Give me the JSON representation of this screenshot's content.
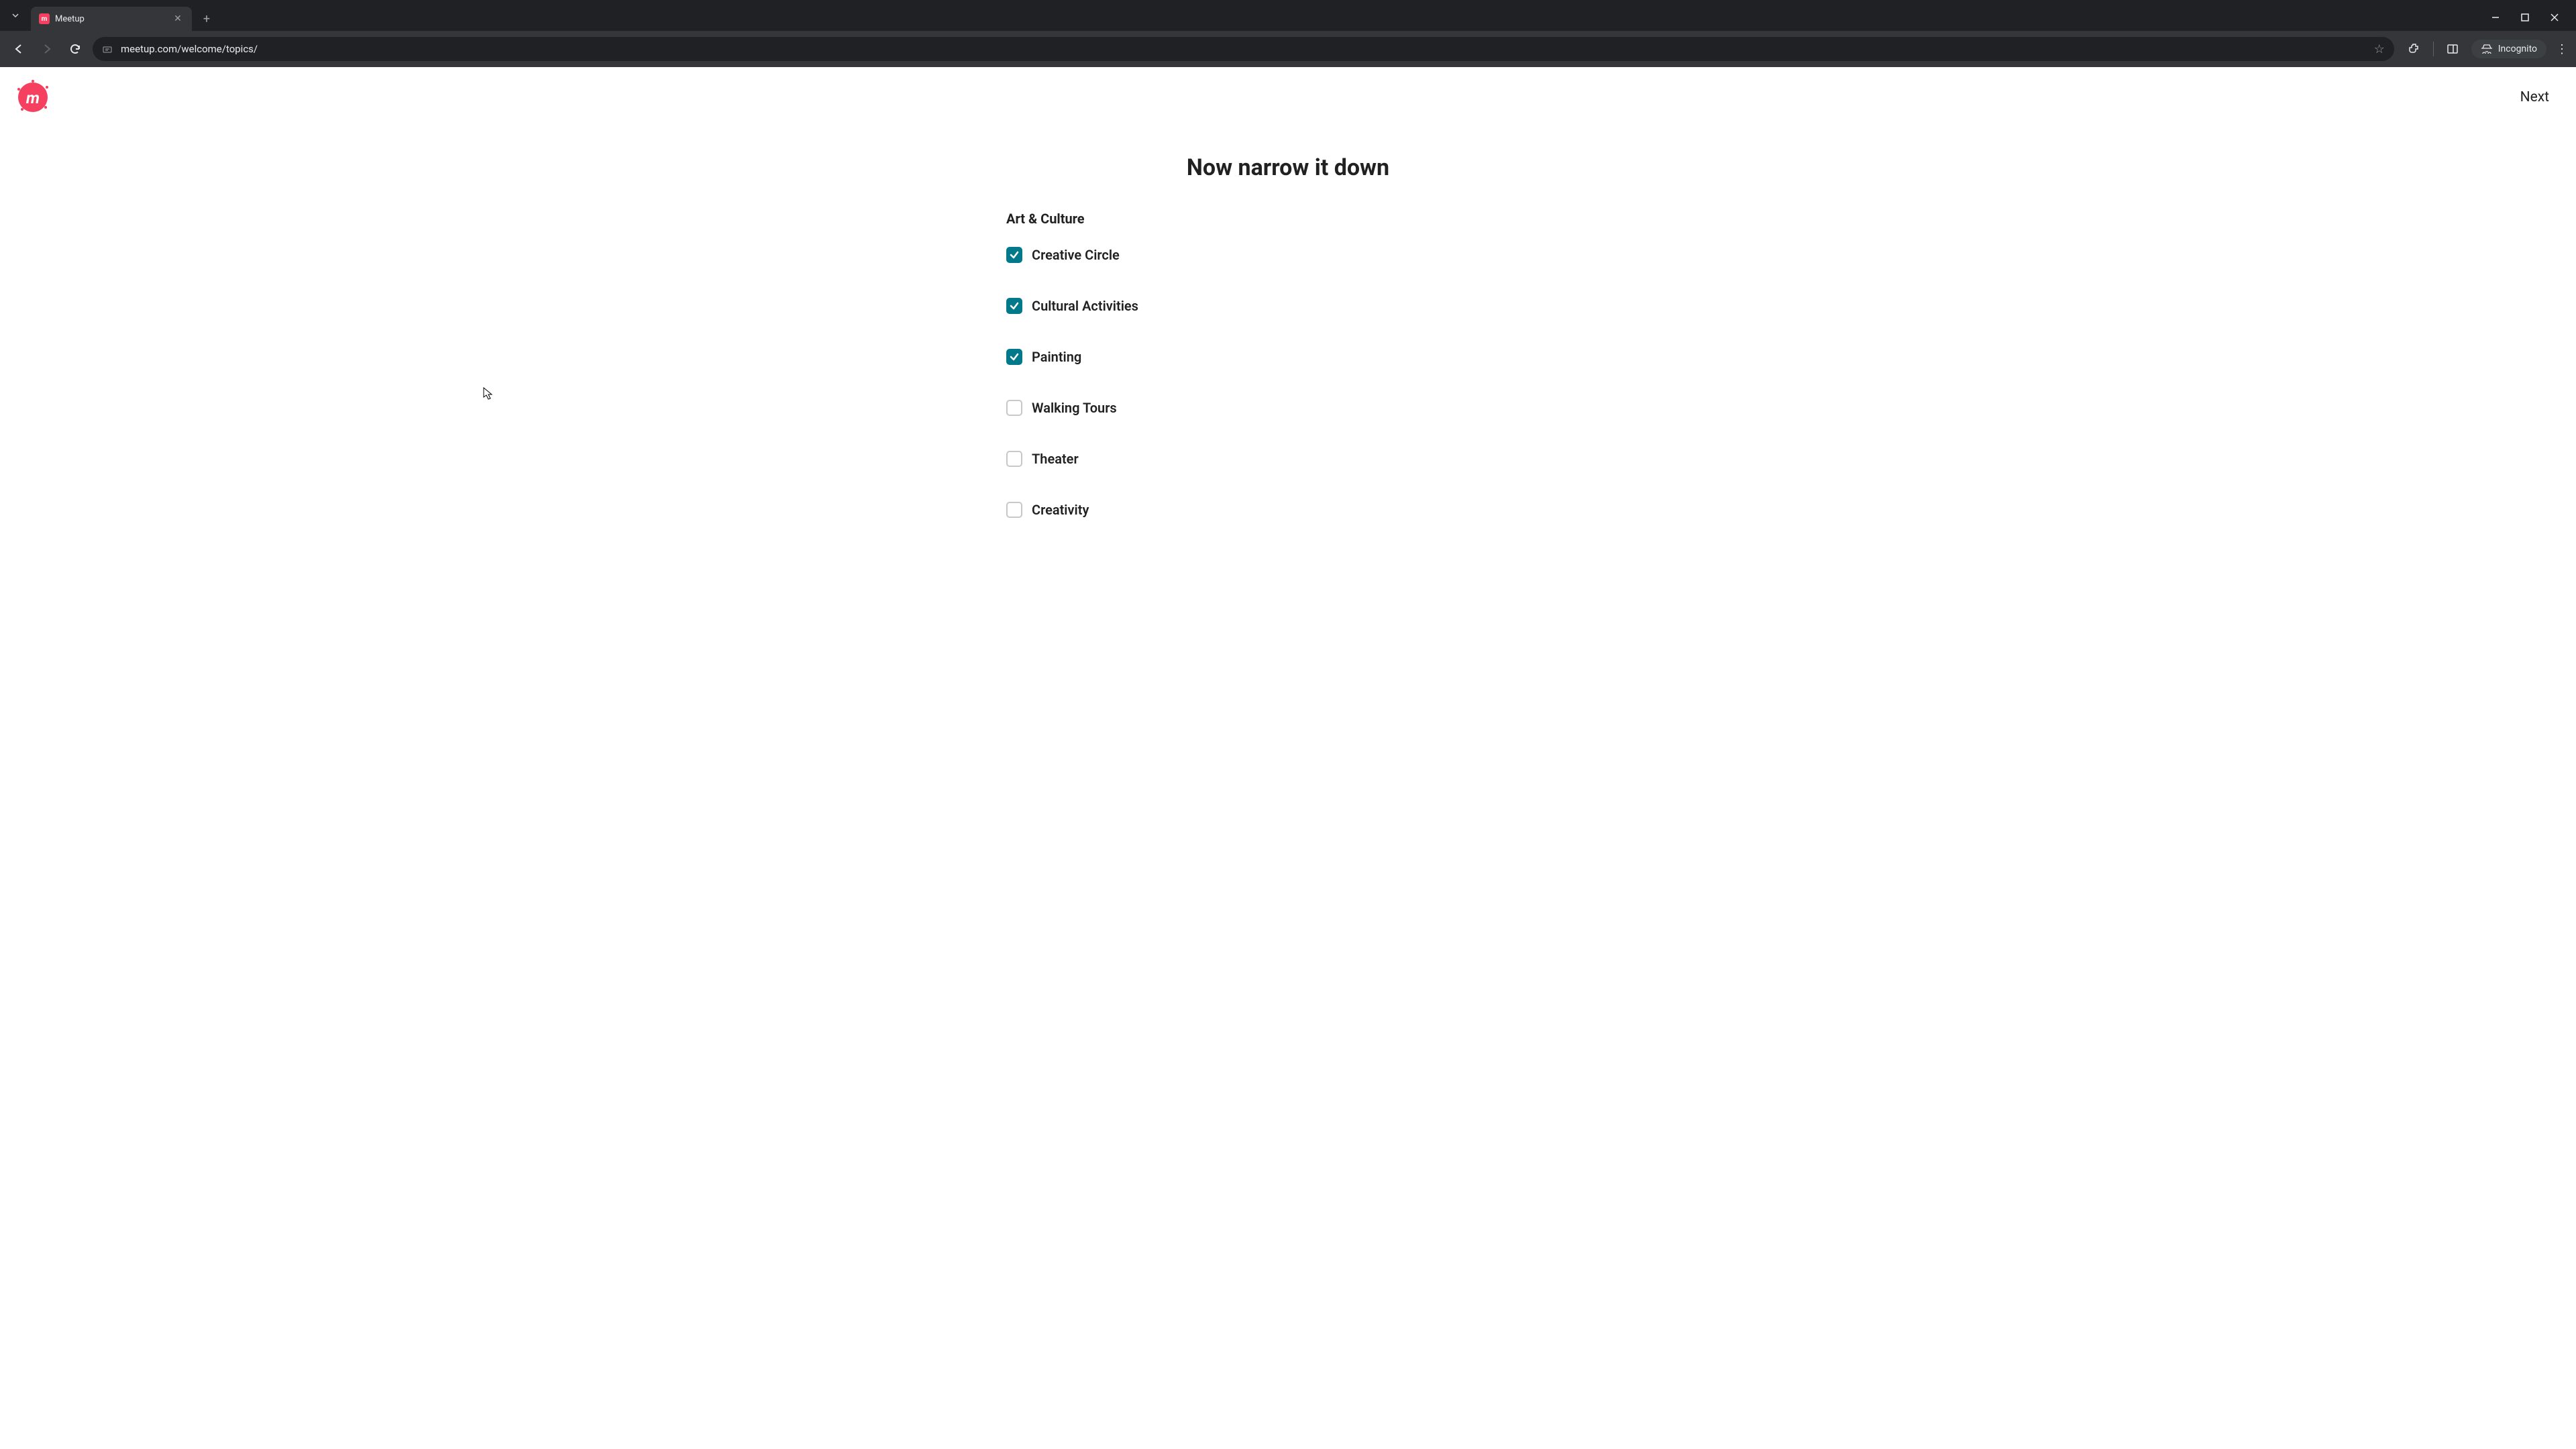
{
  "browser": {
    "tab_title": "Meetup",
    "url": "meetup.com/welcome/topics/",
    "incognito_label": "Incognito"
  },
  "header": {
    "next": "Next"
  },
  "main": {
    "heading": "Now narrow it down",
    "category": "Art & Culture",
    "topics": [
      {
        "label": "Creative Circle",
        "checked": true
      },
      {
        "label": "Cultural Activities",
        "checked": true
      },
      {
        "label": "Painting",
        "checked": true
      },
      {
        "label": "Walking Tours",
        "checked": false
      },
      {
        "label": "Theater",
        "checked": false
      },
      {
        "label": "Creativity",
        "checked": false
      }
    ]
  }
}
